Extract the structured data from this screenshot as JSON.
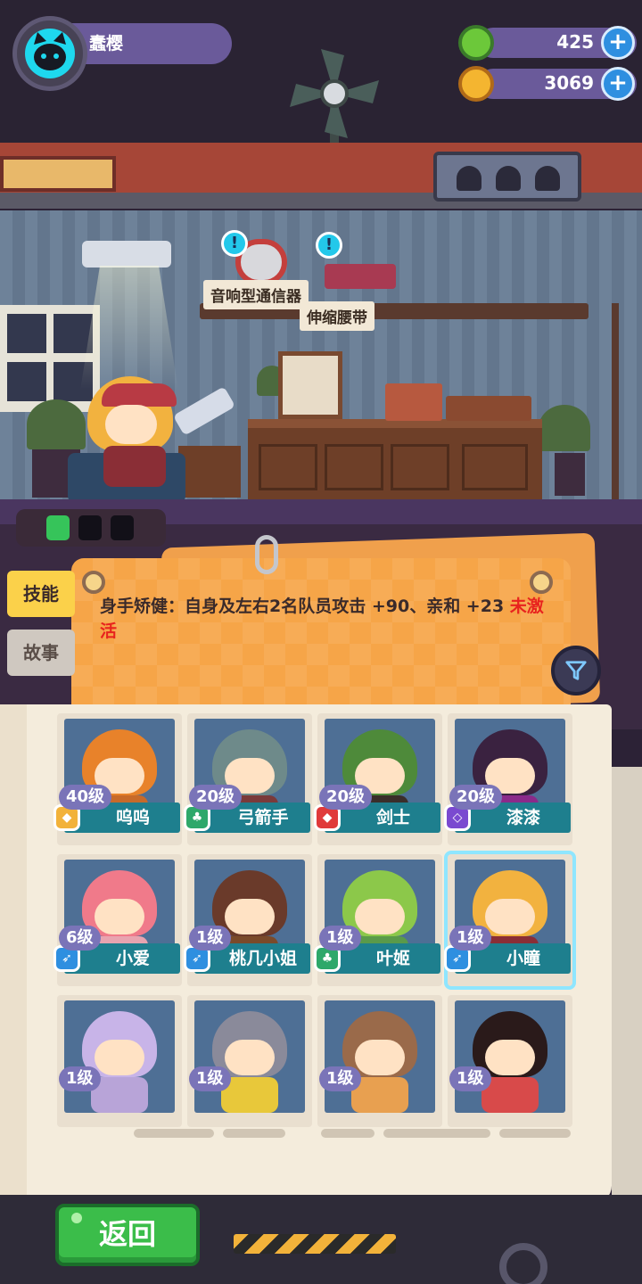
{
  "player": {
    "name": "蠢樱"
  },
  "currencies": [
    {
      "name": "green-gem",
      "value": "425",
      "color": "#6cc83a"
    },
    {
      "name": "gold-planet",
      "value": "3069",
      "color": "#f4b530"
    }
  ],
  "scene": {
    "items": [
      {
        "label": "音响型通信器",
        "alert": "!"
      },
      {
        "label": "伸缩腰带",
        "alert": "!"
      }
    ],
    "battery": {
      "charged": 1,
      "total": 3
    }
  },
  "tabs": [
    {
      "label": "技能",
      "active": true
    },
    {
      "label": "故事",
      "active": false
    }
  ],
  "skill": {
    "description": "身手矫健：自身及左右2名队员攻击 +90、亲和 +23",
    "status": "未激活"
  },
  "filter_icon": "filter-icon",
  "roster": [
    {
      "level": "40级",
      "name": "呜呜",
      "class": "shield",
      "class_color": "#f2b23a",
      "hair": "#e8822a",
      "outfit": "#c76a2a"
    },
    {
      "level": "20级",
      "name": "弓箭手",
      "class": "leaf",
      "class_color": "#2ea86a",
      "hair": "#6e8a8a",
      "outfit": "#7a3a3a"
    },
    {
      "level": "20级",
      "name": "剑士",
      "class": "shield",
      "class_color": "#e03a3a",
      "hair": "#4e8a3a",
      "outfit": "#3a2e2a"
    },
    {
      "level": "20级",
      "name": "漆漆",
      "class": "crystal",
      "class_color": "#7a4ad0",
      "hair": "#3a2240",
      "outfit": "#8a2a8a"
    },
    {
      "level": "6级",
      "name": "小爱",
      "class": "feather",
      "class_color": "#2e8fe0",
      "hair": "#f07a8a",
      "outfit": "#e8a4b0"
    },
    {
      "level": "1级",
      "name": "桃几小姐",
      "class": "feather",
      "class_color": "#2e8fe0",
      "hair": "#6a3a2a",
      "outfit": "#7a4a2a"
    },
    {
      "level": "1级",
      "name": "叶姬",
      "class": "leaf",
      "class_color": "#2ea86a",
      "hair": "#8cc84a",
      "outfit": "#5a9a4a"
    },
    {
      "level": "1级",
      "name": "小瞳",
      "class": "feather",
      "class_color": "#2e8fe0",
      "hair": "#f2b23f",
      "outfit": "#8a2e36",
      "selected": true
    },
    {
      "level": "1级",
      "name": "",
      "class": "",
      "class_color": "",
      "hair": "#c8b4e8",
      "outfit": "#b8a4d8"
    },
    {
      "level": "1级",
      "name": "",
      "class": "",
      "class_color": "",
      "hair": "#8a8a9a",
      "outfit": "#e8c83a"
    },
    {
      "level": "1级",
      "name": "",
      "class": "",
      "class_color": "",
      "hair": "#9a6a4a",
      "outfit": "#e8a050"
    },
    {
      "level": "1级",
      "name": "",
      "class": "",
      "class_color": "",
      "hair": "#2a1a1a",
      "outfit": "#d84a4a"
    }
  ],
  "back_button": {
    "label": "返回"
  }
}
